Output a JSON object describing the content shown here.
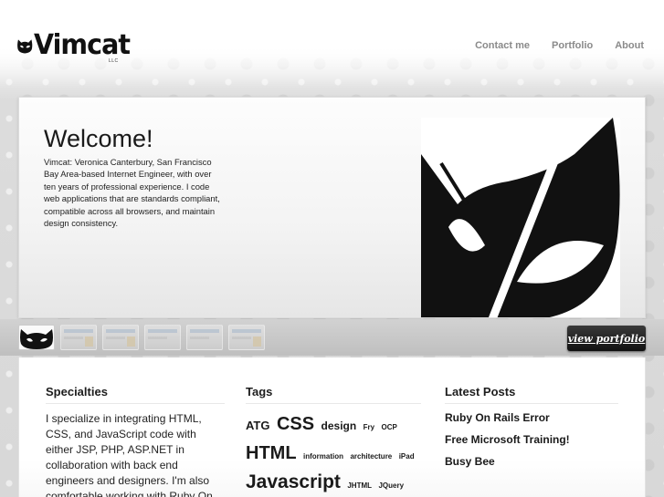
{
  "header": {
    "logo_text": "Vimcat",
    "logo_suffix": "LLC",
    "nav": [
      {
        "label": "Contact me"
      },
      {
        "label": "Portfolio"
      },
      {
        "label": "About"
      }
    ]
  },
  "hero": {
    "title": "Welcome!",
    "body": "Vimcat: Veronica Canterbury, San Francisco Bay Area-based Internet Engineer, with over ten years of professional experience. I code web applications that are standards compliant, compatible across all browsers, and maintain design consistency."
  },
  "strip": {
    "view_portfolio_label": "view portfolio"
  },
  "specialties": {
    "heading": "Specialties",
    "text": "I specialize in integrating HTML, CSS, and JavaScript code with either JSP, PHP, ASP.NET in collaboration with back end engineers and designers. I'm also comfortable working with Ruby On Rails."
  },
  "tags": {
    "heading": "Tags",
    "items": [
      {
        "label": "ATG",
        "size": "md"
      },
      {
        "label": "CSS",
        "size": "xl"
      },
      {
        "label": "design",
        "size": "md"
      },
      {
        "label": "Fry",
        "size": "sm"
      },
      {
        "label": "OCP",
        "size": "sm"
      },
      {
        "label": "HTML",
        "size": "xl"
      },
      {
        "label": "information",
        "size": "sm"
      },
      {
        "label": "architecture",
        "size": "sm"
      },
      {
        "label": "iPad",
        "size": "sm"
      },
      {
        "label": "Javascript",
        "size": "xxl"
      },
      {
        "label": "JHTML",
        "size": "sm"
      },
      {
        "label": "JQuery",
        "size": "sm"
      }
    ]
  },
  "latest_posts": {
    "heading": "Latest Posts",
    "items": [
      {
        "label": "Ruby On Rails Error"
      },
      {
        "label": "Free Microsoft Training!"
      },
      {
        "label": "Busy Bee"
      }
    ]
  },
  "colors": {
    "accent": "#111111",
    "nav_text": "#8a8a8a",
    "background": "#e2e2e2"
  }
}
